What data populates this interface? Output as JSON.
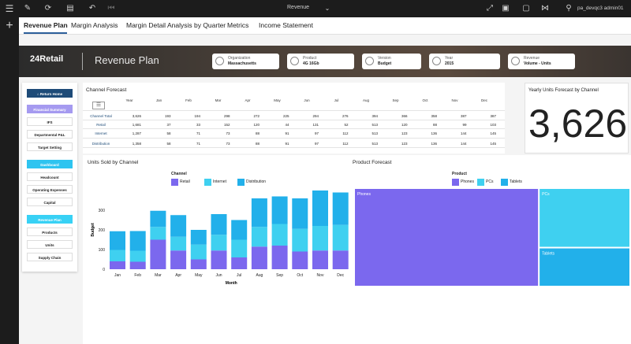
{
  "topbar": {
    "title": "Revenue",
    "user": "pa_devqc3 admin01"
  },
  "tabs": [
    {
      "label": "Revenue Plan"
    },
    {
      "label": "Margin Analysis"
    },
    {
      "label": "Margin Detail Analysis by Quarter"
    },
    {
      "label": "Metrics"
    },
    {
      "label": "Income Statement"
    }
  ],
  "banner": {
    "logo": "24Retail",
    "title": "Revenue Plan",
    "filters": [
      {
        "label": "Organization",
        "value": "Massachusetts"
      },
      {
        "label": "Product",
        "value": "4G 16Gb"
      },
      {
        "label": "Version",
        "value": "Budget"
      },
      {
        "label": "Year",
        "value": "2015"
      },
      {
        "label": "Revenue",
        "value": "Volume - Units"
      }
    ]
  },
  "sidebar": {
    "items": [
      {
        "label": "Return Home",
        "style": "dark"
      },
      {
        "label": "Financial Summary",
        "style": "purple"
      },
      {
        "label": "IFS",
        "style": "plain"
      },
      {
        "label": "Departmental P&L",
        "style": "plain"
      },
      {
        "label": "Target Setting",
        "style": "plain"
      },
      {
        "label": "Dashboard",
        "style": "cyan"
      },
      {
        "label": "Headcount",
        "style": "plain"
      },
      {
        "label": "Operating Expenses",
        "style": "plain"
      },
      {
        "label": "Capital",
        "style": "plain"
      },
      {
        "label": "Revenue Plan",
        "style": "cyan2"
      },
      {
        "label": "Products",
        "style": "plain"
      },
      {
        "label": "Units",
        "style": "plain"
      },
      {
        "label": "Supply Chain",
        "style": "plain"
      }
    ]
  },
  "channel_forecast": {
    "title": "Channel Forecast",
    "columns": [
      "Year",
      "Jan",
      "Feb",
      "Mar",
      "Apr",
      "May",
      "Jun",
      "Jul",
      "Aug",
      "Sep",
      "Oct",
      "Nov",
      "Dec"
    ],
    "rows": [
      {
        "label": "Channel Total",
        "values": [
          "3,626",
          "193",
          "194",
          "298",
          "272",
          "225",
          "294",
          "276",
          "394",
          "366",
          "358",
          "387",
          "387"
        ]
      },
      {
        "label": "Retail",
        "values": [
          "1,681",
          "37",
          "33",
          "152",
          "120",
          "44",
          "131",
          "52",
          "513",
          "120",
          "88",
          "99",
          "103"
        ]
      },
      {
        "label": "Internet",
        "values": [
          "1,287",
          "58",
          "71",
          "73",
          "88",
          "91",
          "97",
          "112",
          "513",
          "123",
          "136",
          "144",
          "145"
        ]
      },
      {
        "label": "Distribution",
        "values": [
          "1,358",
          "58",
          "71",
          "73",
          "88",
          "91",
          "97",
          "112",
          "513",
          "123",
          "136",
          "144",
          "145"
        ]
      }
    ]
  },
  "kpi": {
    "title": "Yearly Units Forecast by Channel",
    "value": "3,626"
  },
  "units_chart": {
    "title": "Units Sold by Channel",
    "legend_title": "Channel",
    "colors": {
      "Retail": "#7b68ee",
      "Internet": "#3fd0f0",
      "Distribution": "#22b0ea"
    }
  },
  "product_forecast": {
    "title": "Product Forecast",
    "legend_title": "Product",
    "items": [
      {
        "label": "Phones",
        "color": "#7b68ee"
      },
      {
        "label": "PCs",
        "color": "#3fd0f0"
      },
      {
        "label": "Tablets",
        "color": "#22b0ea"
      }
    ]
  },
  "chart_data": [
    {
      "type": "bar",
      "title": "Units Sold by Channel",
      "xlabel": "Month",
      "ylabel": "Budget",
      "categories": [
        "Jan",
        "Feb",
        "Mar",
        "Apr",
        "May",
        "Jun",
        "Jul",
        "Aug",
        "Sep",
        "Oct",
        "Nov",
        "Dec"
      ],
      "series": [
        {
          "name": "Retail",
          "values": [
            40,
            38,
            150,
            95,
            50,
            95,
            60,
            115,
            120,
            90,
            95,
            95
          ]
        },
        {
          "name": "Internet",
          "values": [
            58,
            56,
            65,
            70,
            75,
            80,
            90,
            100,
            110,
            115,
            125,
            130
          ]
        },
        {
          "name": "Distribution",
          "values": [
            95,
            100,
            82,
            110,
            75,
            105,
            100,
            145,
            140,
            155,
            180,
            165
          ]
        }
      ],
      "ylim": [
        0,
        400
      ],
      "yticks": [
        0,
        100,
        200,
        300
      ],
      "stacked": true
    },
    {
      "type": "treemap",
      "title": "Product Forecast",
      "categories": [
        "Phones",
        "PCs",
        "Tablets"
      ],
      "values": [
        67,
        20,
        13
      ]
    }
  ]
}
